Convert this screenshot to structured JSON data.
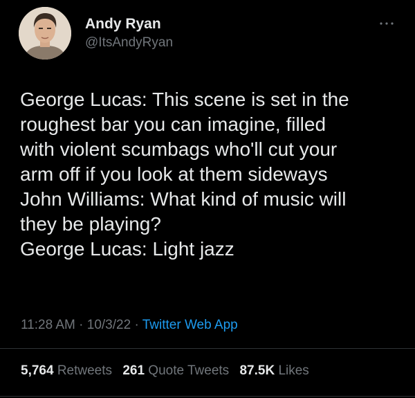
{
  "author": {
    "name": "Andy Ryan",
    "handle": "@ItsAndyRyan"
  },
  "tweet": {
    "lines": [
      "George Lucas: This scene is set in the",
      "roughest bar you can imagine, filled",
      "with violent scumbags who'll cut your",
      "arm off if you look at them sideways",
      "John Williams: What kind of music will",
      "they be playing?",
      "George Lucas: Light jazz"
    ]
  },
  "meta": {
    "time": "11:28 AM",
    "separator": "·",
    "date": "10/3/22",
    "source": "Twitter Web App"
  },
  "stats": {
    "retweets_count": "5,764",
    "retweets_label": "Retweets",
    "quote_count": "261",
    "quote_label": "Quote Tweets",
    "likes_count": "87.5K",
    "likes_label": "Likes"
  },
  "colors": {
    "background": "#000000",
    "text": "#e7e9ea",
    "secondary": "#71767b",
    "link": "#1d9bf0",
    "divider": "#2f3336"
  },
  "icons": {
    "more": "more-horizontal-icon"
  }
}
